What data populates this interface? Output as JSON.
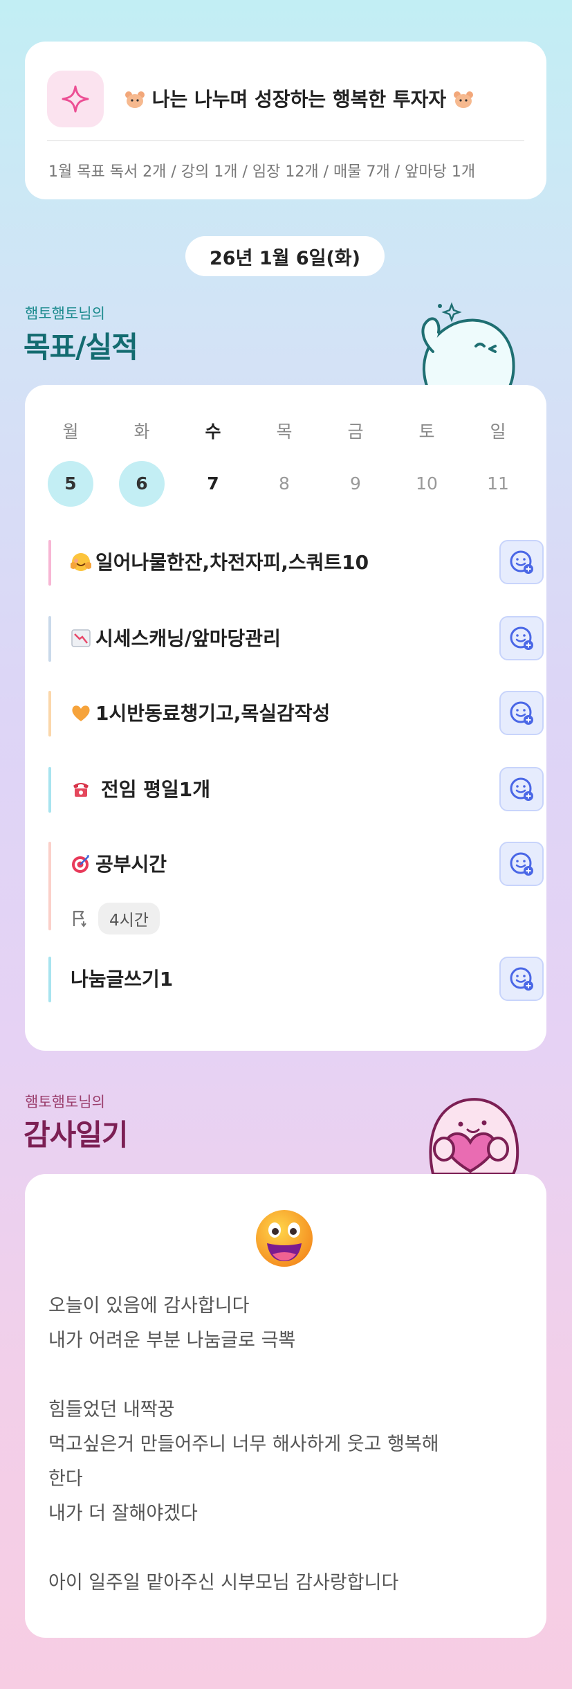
{
  "goal_header": {
    "title": "나는 나누며 성장하는 행복한 투자자",
    "monthly_goals": "1월 목표  독서 2개 / 강의 1개 / 임장 12개 / 매물 7개 / 앞마당 1개"
  },
  "date_label": "26년 1월 6일(화)",
  "goals_section": {
    "subtitle": "햄토햄토님의",
    "title": "목표/실적"
  },
  "week": [
    {
      "dow": "월",
      "day": "5"
    },
    {
      "dow": "화",
      "day": "6"
    },
    {
      "dow": "수",
      "day": "7"
    },
    {
      "dow": "목",
      "day": "8"
    },
    {
      "dow": "금",
      "day": "9"
    },
    {
      "dow": "토",
      "day": "10"
    },
    {
      "dow": "일",
      "day": "11"
    }
  ],
  "tasks": [
    {
      "label": "일어나물한잔,차전자피,스쿼트10",
      "emoji": "hugging-face",
      "bar_color": "#f7b6d4"
    },
    {
      "label": "시세스캐닝/앞마당관리",
      "emoji": "chart-down",
      "bar_color": "#c9d9ea"
    },
    {
      "label": "1시반동료챙기고,목실감작성",
      "emoji": "orange-heart",
      "bar_color": "#fbd7aa"
    },
    {
      "label": "전임 평일1개",
      "emoji": "telephone",
      "bar_color": "#a8e4ef"
    },
    {
      "label": "공부시간",
      "emoji": "direct-hit",
      "bar_color": "#fbd0c9",
      "meta": "4시간"
    },
    {
      "label": "나눔글쓰기1",
      "emoji": "",
      "bar_color": "#a8e4ef"
    }
  ],
  "gratitude_section": {
    "subtitle": "햄토햄토님의",
    "title": "감사일기"
  },
  "gratitude_lines": [
    "오늘이 있음에 감사합니다",
    "내가 어려운 부분 나눔글로 극뽁",
    "",
    "힘들었던 내짝꿍",
    "먹고싶은거 만들어주니 너무 해사하게 웃고 행복해",
    "한다",
    "내가 더 잘해야겠다",
    "",
    "아이 일주일 맡아주신 시부모님 감사랑합니다"
  ],
  "colors": {
    "accent_teal": "#136b70",
    "accent_plum": "#7c1f54",
    "completed_day": "#c3eef4",
    "check_button_bg": "#e6ecfd",
    "check_button_icon": "#4a67e6"
  }
}
